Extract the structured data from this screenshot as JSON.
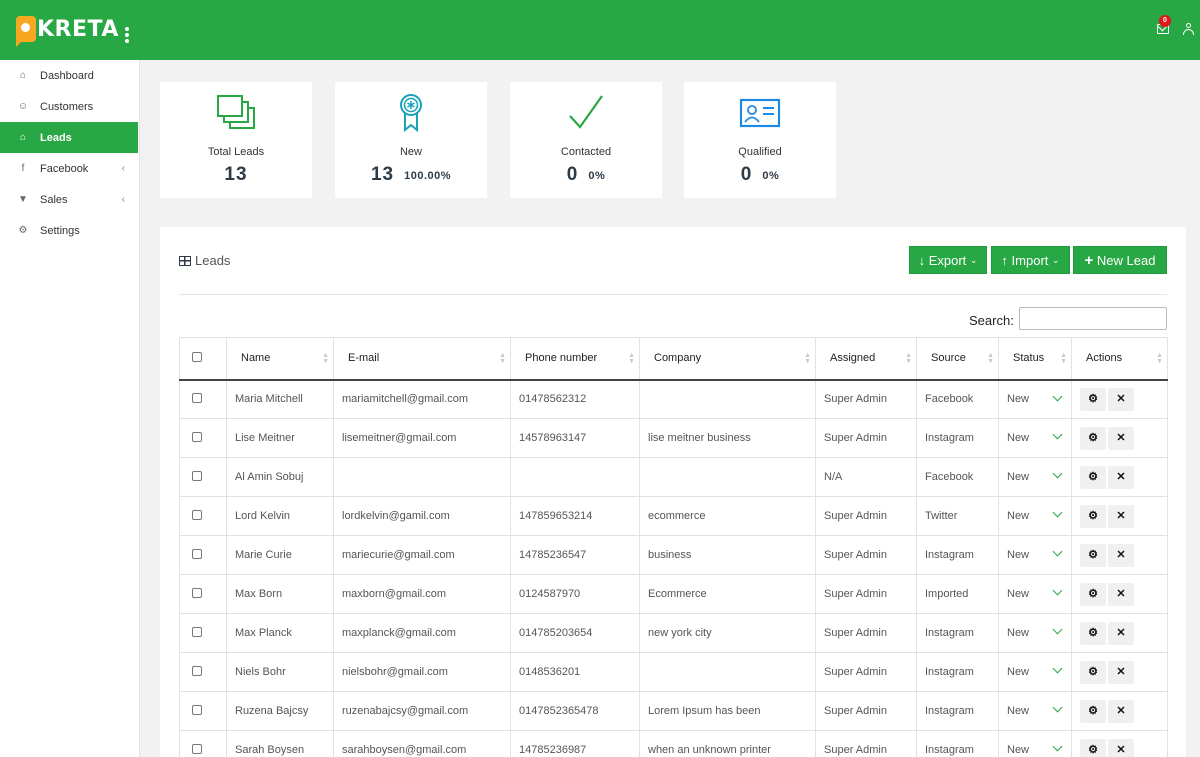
{
  "app": {
    "logo_text": "KRETA"
  },
  "topbar": {
    "notification_count": "0"
  },
  "sidebar": {
    "items": [
      {
        "label": "Dashboard",
        "icon": "home-icon",
        "glyph": "⌂"
      },
      {
        "label": "Customers",
        "icon": "user-icon",
        "glyph": "☺"
      },
      {
        "label": "Leads",
        "icon": "bank-icon",
        "glyph": "⌂"
      },
      {
        "label": "Facebook",
        "icon": "facebook-icon",
        "glyph": "f",
        "chevron": "‹"
      },
      {
        "label": "Sales",
        "icon": "cart-icon",
        "glyph": "▼",
        "chevron": "‹"
      },
      {
        "label": "Settings",
        "icon": "gear-icon",
        "glyph": "⚙"
      }
    ]
  },
  "stats": [
    {
      "label": "Total Leads",
      "value": "13",
      "percent": "",
      "icon": "copy-icon",
      "color": "#28a745"
    },
    {
      "label": "New",
      "value": "13",
      "percent": "100.00%",
      "icon": "award-icon",
      "color": "#17a2b8"
    },
    {
      "label": "Contacted",
      "value": "0",
      "percent": "0%",
      "icon": "check-icon",
      "color": "#28a745"
    },
    {
      "label": "Qualified",
      "value": "0",
      "percent": "0%",
      "icon": "id-card-icon",
      "color": "#1e88e5"
    }
  ],
  "panel": {
    "title": "Leads",
    "buttons": {
      "export": "Export",
      "import": "Import",
      "new_lead": "New Lead"
    },
    "search_label": "Search:"
  },
  "table": {
    "columns": [
      "Name",
      "E-mail",
      "Phone number",
      "Company",
      "Assigned",
      "Source",
      "Status",
      "Actions"
    ],
    "rows": [
      {
        "name": "Maria Mitchell",
        "email": "mariamitchell@gmail.com",
        "phone": "01478562312",
        "company": "",
        "assigned": "Super Admin",
        "source": "Facebook",
        "status": "New"
      },
      {
        "name": "Lise Meitner",
        "email": "lisemeitner@gmail.com",
        "phone": "14578963147",
        "company": "lise meitner business",
        "assigned": "Super Admin",
        "source": "Instagram",
        "status": "New"
      },
      {
        "name": "Al Amin Sobuj",
        "email": "",
        "phone": "",
        "company": "",
        "assigned": "N/A",
        "source": "Facebook",
        "status": "New"
      },
      {
        "name": "Lord Kelvin",
        "email": "lordkelvin@gamil.com",
        "phone": "147859653214",
        "company": "ecommerce",
        "assigned": "Super Admin",
        "source": "Twitter",
        "status": "New"
      },
      {
        "name": "Marie Curie",
        "email": "mariecurie@gmail.com",
        "phone": "14785236547",
        "company": "business",
        "assigned": "Super Admin",
        "source": "Instagram",
        "status": "New"
      },
      {
        "name": "Max Born",
        "email": "maxborn@gmail.com",
        "phone": "0124587970",
        "company": "Ecommerce",
        "assigned": "Super Admin",
        "source": "Imported",
        "status": "New"
      },
      {
        "name": "Max Planck",
        "email": "maxplanck@gmail.com",
        "phone": "014785203654",
        "company": "new york city",
        "assigned": "Super Admin",
        "source": "Instagram",
        "status": "New"
      },
      {
        "name": "Niels Bohr",
        "email": "nielsbohr@gmail.com",
        "phone": "0148536201",
        "company": "",
        "assigned": "Super Admin",
        "source": "Instagram",
        "status": "New"
      },
      {
        "name": "Ruzena Bajcsy",
        "email": "ruzenabajcsy@gmail.com",
        "phone": "0147852365478",
        "company": "Lorem Ipsum has been",
        "assigned": "Super Admin",
        "source": "Instagram",
        "status": "New"
      },
      {
        "name": "Sarah Boysen",
        "email": "sarahboysen@gmail.com",
        "phone": "14785236987",
        "company": "when an unknown printer",
        "assigned": "Super Admin",
        "source": "Instagram",
        "status": "New"
      }
    ]
  }
}
